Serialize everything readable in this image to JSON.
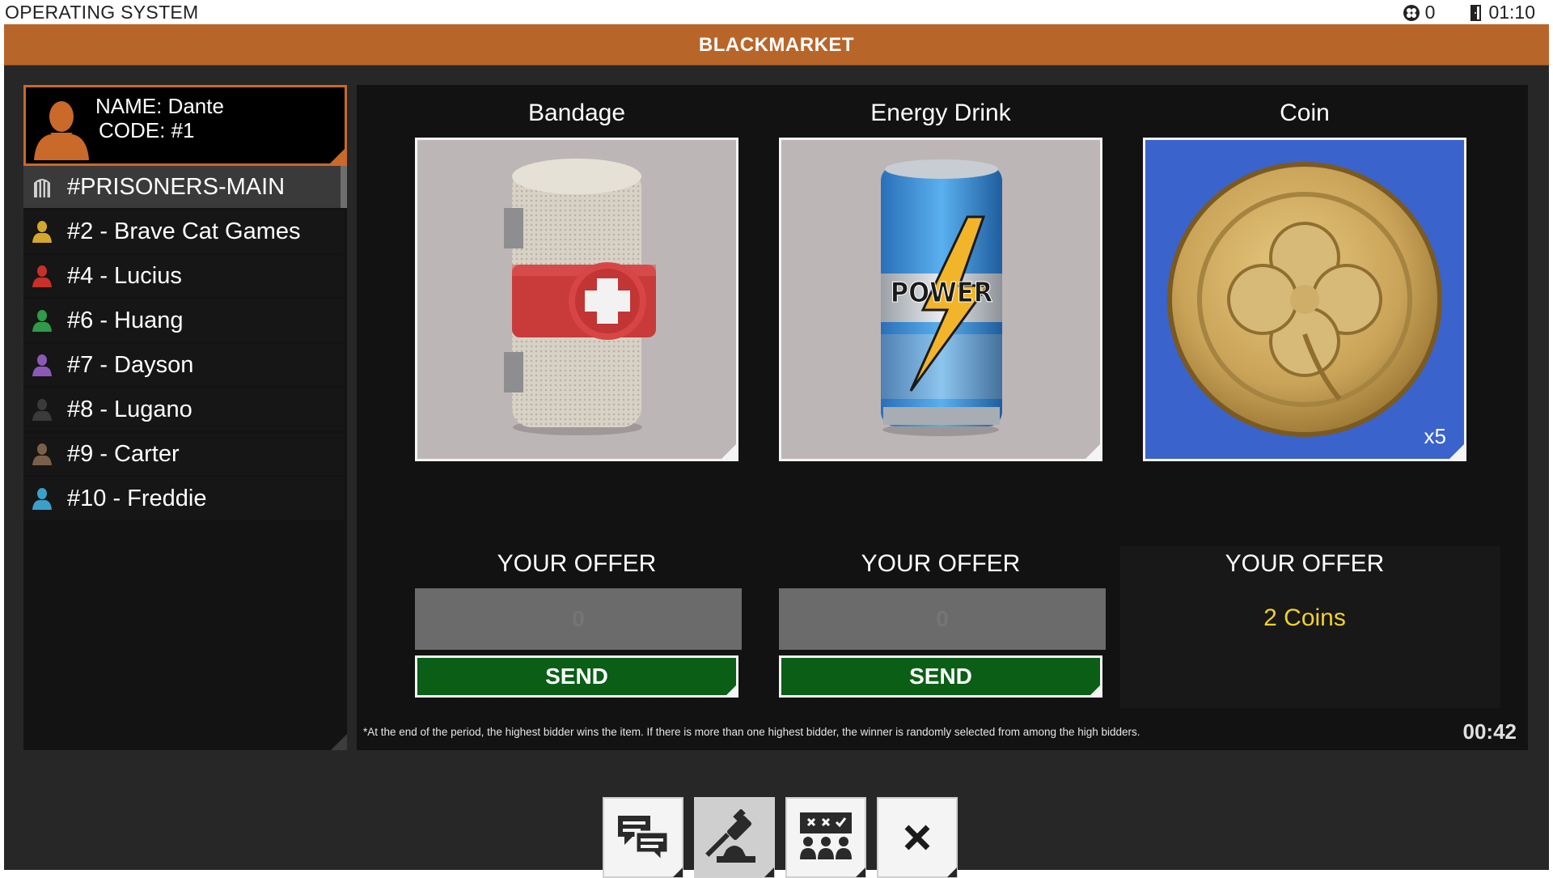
{
  "os": {
    "title": "OPERATING SYSTEM",
    "coins": "0",
    "time": "01:10"
  },
  "app": {
    "title": "BLACKMARKET"
  },
  "profile": {
    "name": "NAME: Dante",
    "code": "CODE: #1"
  },
  "channels": [
    {
      "label": "#PRISONERS-MAIN",
      "color": "#cfcfcf",
      "icon": "prison-icon",
      "active": true
    },
    {
      "label": "#2 - Brave Cat Games",
      "color": "#d4a82a",
      "icon": "user-icon"
    },
    {
      "label": "#4 - Lucius",
      "color": "#c8302a",
      "icon": "user-icon"
    },
    {
      "label": "#6 - Huang",
      "color": "#2f9a4a",
      "icon": "user-icon"
    },
    {
      "label": "#7 - Dayson",
      "color": "#8a5ab5",
      "icon": "user-icon"
    },
    {
      "label": "#8 - Lugano",
      "color": "#3a3a3a",
      "icon": "user-icon"
    },
    {
      "label": "#9 - Carter",
      "color": "#7a6048",
      "icon": "user-icon"
    },
    {
      "label": "#10 - Freddie",
      "color": "#3aa0c8",
      "icon": "user-icon"
    }
  ],
  "items": [
    {
      "title": "Bandage",
      "bg": "#bdb6b6"
    },
    {
      "title": "Energy Drink",
      "bg": "#bdb6b6"
    },
    {
      "title": "Coin",
      "bg": "#3b63cc",
      "qty": "x5"
    }
  ],
  "offers": [
    {
      "label": "YOUR OFFER",
      "placeholder": "0",
      "send": "SEND"
    },
    {
      "label": "YOUR OFFER",
      "placeholder": "0",
      "send": "SEND"
    },
    {
      "label": "YOUR OFFER",
      "value": "2 Coins"
    }
  ],
  "footnote": "*At the end of the period, the highest bidder wins the item. If there is more than one highest bidder, the winner is randomly selected from among the high bidders.",
  "timer": "00:42",
  "toolbar": [
    {
      "icon": "chat-icon"
    },
    {
      "icon": "auction-icon",
      "active": true
    },
    {
      "icon": "vote-icon"
    },
    {
      "icon": "close-icon"
    }
  ],
  "colors": {
    "accent": "#b8652a",
    "send": "#0a5e16",
    "offer_value": "#f1d02a"
  }
}
